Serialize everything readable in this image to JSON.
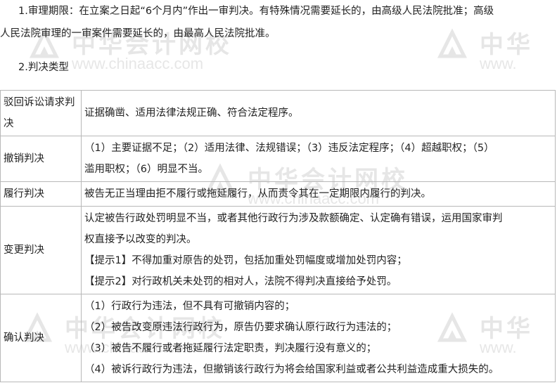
{
  "paragraphs": {
    "p1_line1": "1.审理期限：在立案之日起“6个月内”作出一审判决。有特殊情况需要延长的，由高级人民法院批准；高级",
    "p1_line2": "人民法院审理的一审案件需要延长的，由最高人民法院批准。",
    "p2": "2.判决类型"
  },
  "table": {
    "rows": [
      {
        "type_lines": [
          "驳回诉讼请求判",
          "决"
        ],
        "content_lines": [
          "证据确凿、适用法律法规正确、符合法定程序。"
        ]
      },
      {
        "type_lines": [
          "撤销判决"
        ],
        "content_lines": [
          "（1）主要证据不足；（2）适用法律、法规错误；（3）违反法定程序；（4）超越职权；（5）",
          "滥用职权；（6）明显不当。"
        ]
      },
      {
        "type_lines": [
          "履行判决"
        ],
        "content_lines": [
          "被告无正当理由拒不履行或拖延履行，从而责令其在一定期限内履行的判决。"
        ]
      },
      {
        "type_lines": [
          "变更判决"
        ],
        "content_lines": [
          "认定被告行政处罚明显不当，或者其他行政行为涉及款额确定、认定确有错误，运用国家审判",
          "权直接予以改变的判决。",
          "【提示1】不得加重对原告的处罚，包括加重处罚幅度或增加处罚内容；",
          "【提示2】对行政机关未处罚的相对人，法院不得判决直接给予处罚。"
        ]
      },
      {
        "type_lines": [
          "确认判决"
        ],
        "content_lines": [
          "（1）行政行为违法，但不具有可撤销内容的；",
          "（2）被告改变原违法行政行为，原告仍要求确认原行政行为违法的；",
          "（3）被告不履行或者拖延履行法定职责，判决履行没有意义的；",
          "（4）被诉行政行为违法，但撤销该行政行为将会给国家利益或者公共利益造成重大损失的。"
        ]
      }
    ]
  },
  "watermark": {
    "cn": "中华会计网校",
    "cn_short": "中华",
    "en": "www.chinaacc.com",
    "en_short": "www."
  }
}
